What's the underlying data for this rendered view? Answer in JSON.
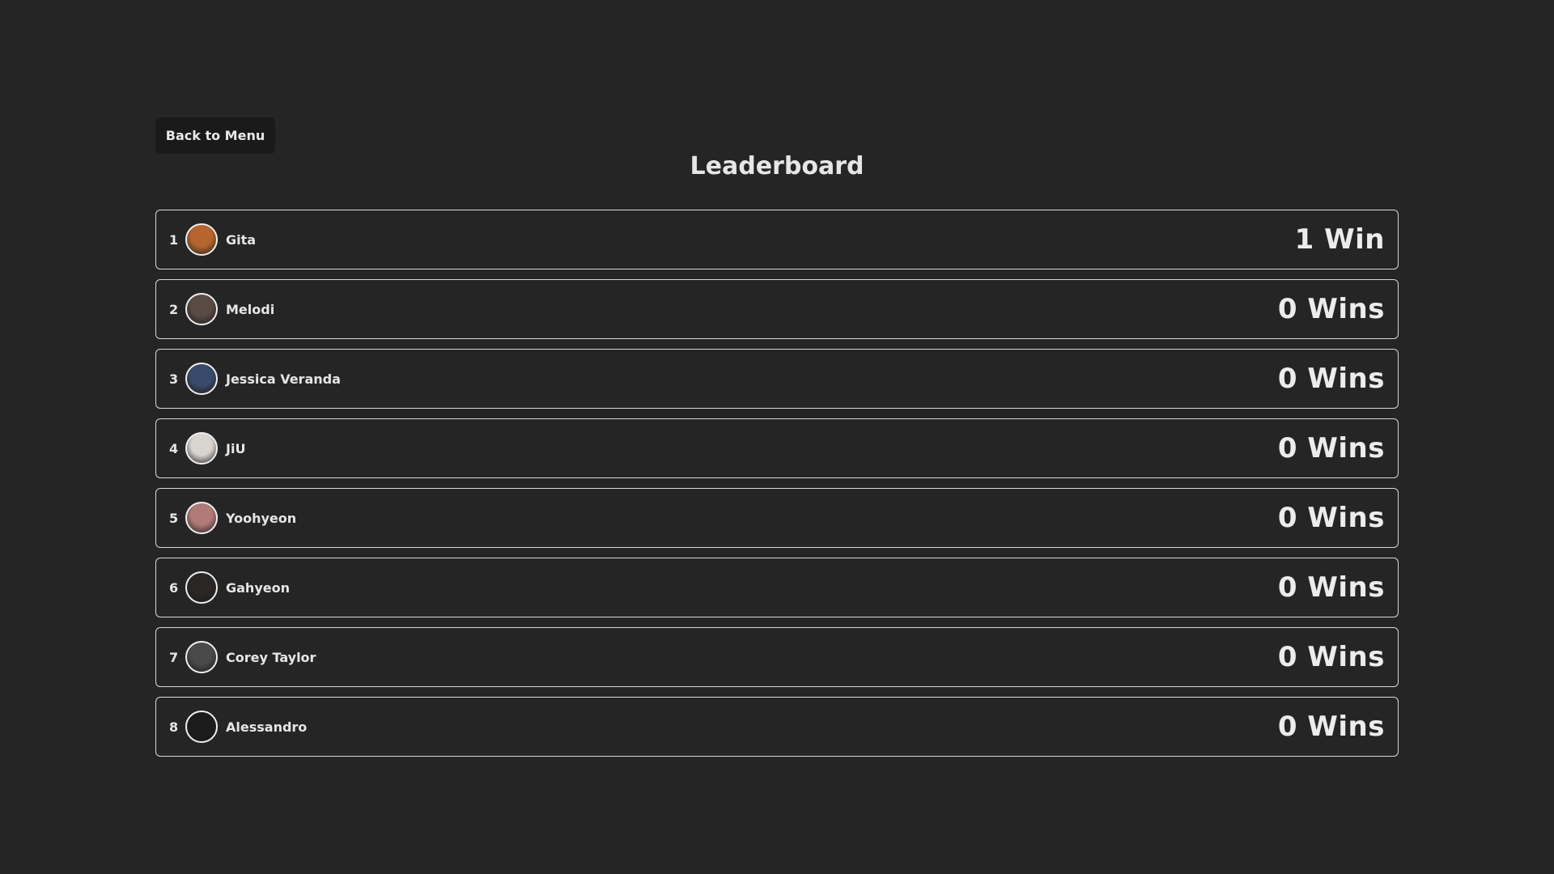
{
  "header": {
    "back_label": "Back to Menu",
    "title": "Leaderboard"
  },
  "players": [
    {
      "rank": "1",
      "name": "Gita",
      "wins": "1 Win",
      "avatar_color": "#b5652d"
    },
    {
      "rank": "2",
      "name": "Melodi",
      "wins": "0 Wins",
      "avatar_color": "#5a4a44"
    },
    {
      "rank": "3",
      "name": "Jessica Veranda",
      "wins": "0 Wins",
      "avatar_color": "#3a4a6a"
    },
    {
      "rank": "4",
      "name": "JiU",
      "wins": "0 Wins",
      "avatar_color": "#d8d4d0"
    },
    {
      "rank": "5",
      "name": "Yoohyeon",
      "wins": "0 Wins",
      "avatar_color": "#b07a78"
    },
    {
      "rank": "6",
      "name": "Gahyeon",
      "wins": "0 Wins",
      "avatar_color": "#2a2624"
    },
    {
      "rank": "7",
      "name": "Corey Taylor",
      "wins": "0 Wins",
      "avatar_color": "#4a4a4a"
    },
    {
      "rank": "8",
      "name": "Alessandro",
      "wins": "0 Wins",
      "avatar_color": "#1c1c1c"
    }
  ],
  "colors": {
    "background": "#252525",
    "row_border": "#d9d9d9",
    "button_bg": "#1a1a1a",
    "text": "#e6e6e6"
  }
}
